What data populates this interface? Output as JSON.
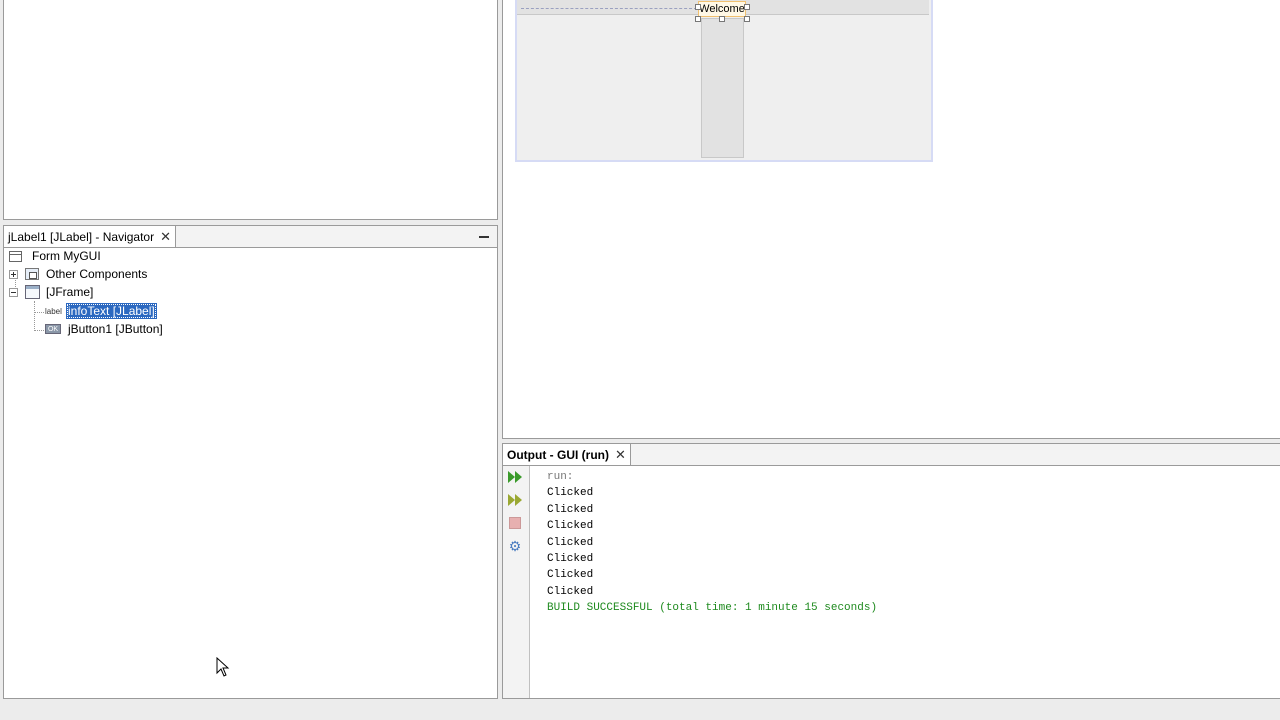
{
  "navigator": {
    "tab_title": "jLabel1 [JLabel] - Navigator",
    "tree": [
      {
        "label": "Form MyGUI",
        "icon": "form-icon"
      },
      {
        "label": "Other Components",
        "icon": "other-components-icon",
        "collapsed": true
      },
      {
        "label": "[JFrame]",
        "icon": "jframe-icon",
        "collapsed": false
      },
      {
        "label": "infoText [JLabel]",
        "icon": "label-icon",
        "icon_text": "label",
        "selected": true
      },
      {
        "label": "jButton1 [JButton]",
        "icon": "button-icon",
        "icon_text": "OK"
      }
    ]
  },
  "designer": {
    "welcome_label": "Welcome"
  },
  "output": {
    "tab_title": "Output - GUI (run)",
    "toolbar": [
      "rerun-icon",
      "rerun-with-options-icon",
      "stop-icon",
      "settings-icon"
    ],
    "lines": [
      {
        "text": "run:",
        "kind": "run"
      },
      {
        "text": "Clicked",
        "kind": "normal"
      },
      {
        "text": "Clicked",
        "kind": "normal"
      },
      {
        "text": "Clicked",
        "kind": "normal"
      },
      {
        "text": "Clicked",
        "kind": "normal"
      },
      {
        "text": "Clicked",
        "kind": "normal"
      },
      {
        "text": "Clicked",
        "kind": "normal"
      },
      {
        "text": "Clicked",
        "kind": "normal"
      },
      {
        "text": "BUILD SUCCESSFUL (total time: 1 minute 15 seconds)",
        "kind": "success"
      }
    ]
  },
  "colors": {
    "selection": "#2b68c0",
    "success_text": "#1e8a1e"
  }
}
